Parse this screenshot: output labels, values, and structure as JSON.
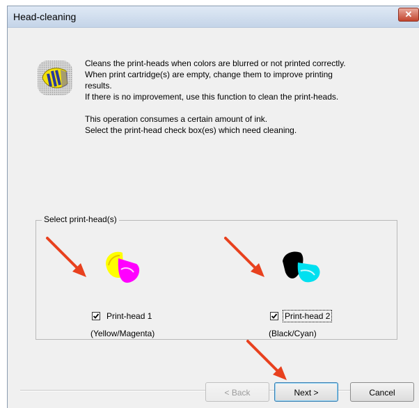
{
  "window": {
    "title": "Head-cleaning",
    "close_glyph": "✕"
  },
  "description": {
    "lines": [
      "Cleans the print-heads when colors are blurred or not printed correctly.",
      "When print cartridge(s) are empty, change them to improve printing",
      "results.",
      "If there is no improvement, use this function to clean the print-heads."
    ],
    "lines2": [
      "This operation consumes a certain amount of ink.",
      "Select the print-head check box(es) which need cleaning."
    ]
  },
  "group": {
    "legend": "Select print-head(s)",
    "heads": [
      {
        "label": "Print-head 1",
        "sublabel": "(Yellow/Magenta)",
        "checked": true,
        "colors": [
          "#ffff00",
          "#ff00ff"
        ]
      },
      {
        "label": "Print-head 2",
        "sublabel": "(Black/Cyan)",
        "checked": true,
        "colors": [
          "#000000",
          "#00ffff"
        ]
      }
    ]
  },
  "buttons": {
    "back": "< Back",
    "next": "Next >",
    "cancel": "Cancel"
  },
  "annotation_color": "#e8411e",
  "icons": [
    "close-icon",
    "printer-head-icon",
    "checkmark-icon",
    "arrow-annotation-icon"
  ]
}
